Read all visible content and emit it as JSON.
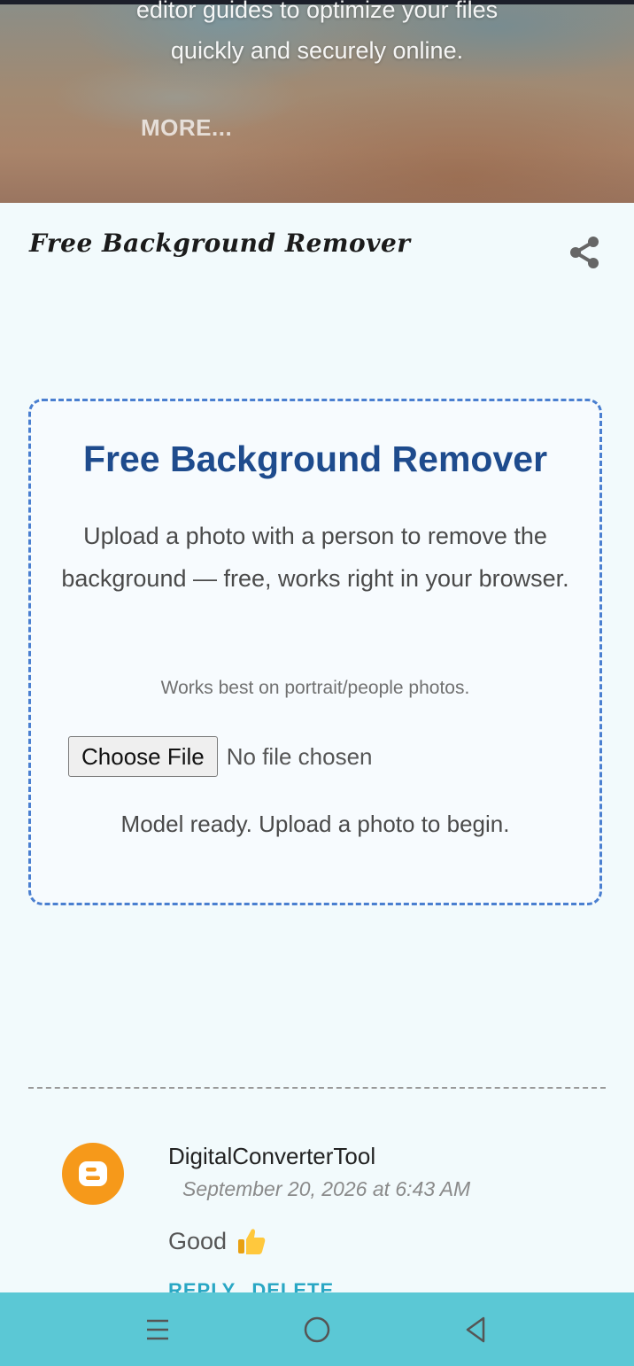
{
  "hero": {
    "description_line1": "editor guides to optimize your files",
    "description_line2": "quickly and securely online.",
    "more_label": "MORE..."
  },
  "post": {
    "title": "Free Background Remover"
  },
  "tool": {
    "heading": "Free Background Remover",
    "intro": "Upload a photo with a person to remove the background — free, works right in your browser.",
    "note": "Works best on portrait/people photos.",
    "choose_file_label": "Choose File",
    "file_status": "No file chosen",
    "model_status": "Model ready. Upload a photo to begin."
  },
  "comment": {
    "author": "DigitalConverterTool",
    "date": "September 20, 2026 at 6:43 AM",
    "body": "Good",
    "emoji_icon": "thumbs-up-icon",
    "reply_label": "REPLY",
    "delete_label": "DELETE"
  },
  "system_nav": {
    "icons": [
      "menu-icon",
      "home-circle-icon",
      "back-triangle-icon"
    ]
  },
  "colors": {
    "page_bg": "#f2fafc",
    "heading_blue": "#1e4b8d",
    "card_border": "#4a7fd0",
    "link_teal": "#2aa7c4",
    "blogger_orange": "#f6991a",
    "nav_bar": "#5bc8d5"
  }
}
